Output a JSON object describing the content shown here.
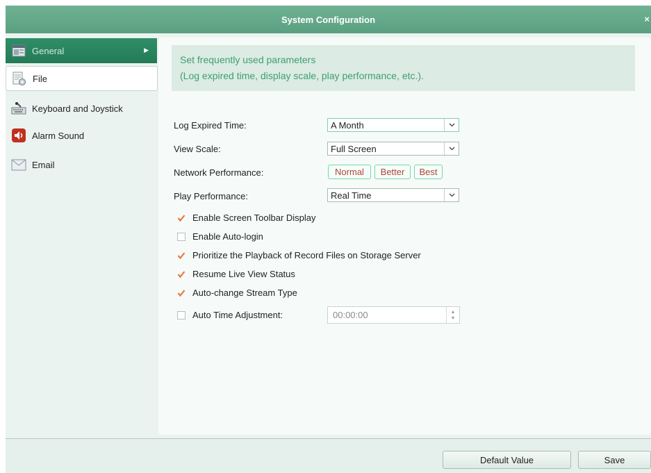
{
  "window": {
    "title": "System Configuration",
    "close_glyph": "×"
  },
  "sidebar": {
    "items": [
      {
        "label": "General",
        "icon": "general-window-icon"
      },
      {
        "label": "File",
        "icon": "file-gear-icon"
      },
      {
        "label": "Keyboard and Joystick",
        "icon": "keyboard-icon"
      },
      {
        "label": "Alarm Sound",
        "icon": "alarm-speaker-icon"
      },
      {
        "label": "Email",
        "icon": "envelope-icon"
      }
    ]
  },
  "info": {
    "line1": "Set frequently used parameters",
    "line2": "(Log expired time, display scale, play performance, etc.)."
  },
  "settings": {
    "log_expired": {
      "label": "Log Expired Time:",
      "value": "A Month"
    },
    "view_scale": {
      "label": "View Scale:",
      "value": "Full Screen"
    },
    "network_performance": {
      "label": "Network Performance:",
      "options": [
        "Normal",
        "Better",
        "Best"
      ]
    },
    "play_performance": {
      "label": "Play Performance:",
      "value": "Real Time"
    }
  },
  "checkboxes": [
    {
      "label": "Enable Screen Toolbar Display",
      "checked": true
    },
    {
      "label": "Enable Auto-login",
      "checked": false
    },
    {
      "label": "Prioritize the Playback of Record Files on Storage Server",
      "checked": true
    },
    {
      "label": "Resume Live View Status",
      "checked": true
    },
    {
      "label": "Auto-change Stream Type",
      "checked": true
    },
    {
      "label": "Auto Time Adjustment:",
      "checked": false
    }
  ],
  "auto_time": {
    "value": "00:00:00"
  },
  "footer": {
    "default_label": "Default Value",
    "save_label": "Save"
  },
  "colors": {
    "title_bar": "#64a98a",
    "accent": "#e8793c",
    "info_text": "#3e9e72",
    "perf_text": "#b3423a"
  }
}
